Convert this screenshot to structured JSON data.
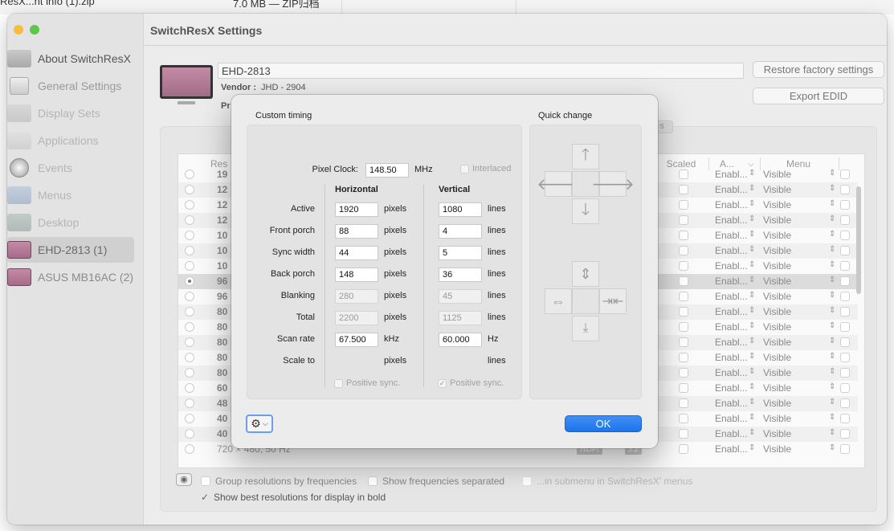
{
  "background": {
    "file_name": "ResX...nt info (1).zip",
    "file_meta": "7.0 MB — ZIP归档"
  },
  "window": {
    "title": "SwitchResX Settings"
  },
  "sidebar": {
    "items": [
      {
        "label": "About SwitchResX"
      },
      {
        "label": "General Settings"
      },
      {
        "label": "Display Sets"
      },
      {
        "label": "Applications"
      },
      {
        "label": "Events"
      },
      {
        "label": "Menus"
      },
      {
        "label": "Desktop"
      },
      {
        "label": "EHD-2813 (1)"
      },
      {
        "label": "ASUS MB16AC (2)"
      }
    ]
  },
  "display": {
    "name": "EHD-2813",
    "vendor_label": "Vendor :",
    "vendor_value": "JHD - 2904",
    "pr_label": "Pr",
    "restore_button": "Restore factory settings",
    "export_button": "Export EDID",
    "tab_hint": "s"
  },
  "table": {
    "headers": {
      "res": "Res",
      "scaled": "Scaled",
      "a": "A...",
      "menu": "Menu"
    },
    "rows": [
      {
        "res": "19",
        "enabled": "Enabl...",
        "visible": "Visible",
        "selected": false,
        "bold": true
      },
      {
        "res": "12",
        "enabled": "Enabl...",
        "visible": "Visible",
        "selected": false,
        "bold": true
      },
      {
        "res": "12",
        "enabled": "Enabl...",
        "visible": "Visible",
        "selected": false,
        "bold": true
      },
      {
        "res": "12",
        "enabled": "Enabl...",
        "visible": "Visible",
        "selected": false,
        "bold": true
      },
      {
        "res": "10",
        "enabled": "Enabl...",
        "visible": "Visible",
        "selected": false,
        "bold": true
      },
      {
        "res": "10",
        "enabled": "Enabl...",
        "visible": "Visible",
        "selected": false,
        "bold": true
      },
      {
        "res": "10",
        "enabled": "Enabl...",
        "visible": "Visible",
        "selected": false,
        "bold": true
      },
      {
        "res": "96",
        "enabled": "Enabl...",
        "visible": "Visible",
        "selected": true,
        "bold": true
      },
      {
        "res": "96",
        "enabled": "Enabl...",
        "visible": "Visible",
        "selected": false,
        "bold": true
      },
      {
        "res": "80",
        "enabled": "Enabl...",
        "visible": "Visible",
        "selected": false,
        "bold": true
      },
      {
        "res": "80",
        "enabled": "Enabl...",
        "visible": "Visible",
        "selected": false,
        "bold": true
      },
      {
        "res": "80",
        "enabled": "Enabl...",
        "visible": "Visible",
        "selected": false,
        "bold": true
      },
      {
        "res": "80",
        "enabled": "Enabl...",
        "visible": "Visible",
        "selected": false,
        "bold": true
      },
      {
        "res": "80",
        "enabled": "Enabl...",
        "visible": "Visible",
        "selected": false,
        "bold": true
      },
      {
        "res": "60",
        "enabled": "Enabl...",
        "visible": "Visible",
        "selected": false,
        "bold": true
      },
      {
        "res": "48",
        "enabled": "Enabl...",
        "visible": "Visible",
        "selected": false,
        "bold": true
      },
      {
        "res": "40",
        "enabled": "Enabl...",
        "visible": "Visible",
        "selected": false,
        "bold": true
      },
      {
        "res": "40",
        "enabled": "Enabl...",
        "visible": "Visible",
        "selected": false,
        "bold": true
      },
      {
        "res": "720 × 480, 50 Hz",
        "enabled": "Enabl...",
        "visible": "Visible",
        "selected": false,
        "bold": false,
        "badge1": "HiDPI",
        "badge2": "3:2"
      }
    ]
  },
  "options": {
    "group_by_freq": "Group resolutions by frequencies",
    "show_freq_separated": "Show frequencies separated",
    "in_submenu": "...in submenu in SwitchResX' menus",
    "show_best_bold": "Show best resolutions for display in bold"
  },
  "dialog": {
    "custom_timing_title": "Custom timing",
    "quick_change_title": "Quick change",
    "pixel_clock_label": "Pixel Clock:",
    "pixel_clock_value": "148.50",
    "pixel_clock_unit": "MHz",
    "interlaced_label": "Interlaced",
    "horizontal_head": "Horizontal",
    "vertical_head": "Vertical",
    "rows": [
      {
        "label": "Active",
        "h": "1920",
        "h_unit": "pixels",
        "v": "1080",
        "v_unit": "lines",
        "disabled": false
      },
      {
        "label": "Front porch",
        "h": "88",
        "h_unit": "pixels",
        "v": "4",
        "v_unit": "lines",
        "disabled": false
      },
      {
        "label": "Sync width",
        "h": "44",
        "h_unit": "pixels",
        "v": "5",
        "v_unit": "lines",
        "disabled": false
      },
      {
        "label": "Back porch",
        "h": "148",
        "h_unit": "pixels",
        "v": "36",
        "v_unit": "lines",
        "disabled": false
      },
      {
        "label": "Blanking",
        "h": "280",
        "h_unit": "pixels",
        "v": "45",
        "v_unit": "lines",
        "disabled": true
      },
      {
        "label": "Total",
        "h": "2200",
        "h_unit": "pixels",
        "v": "1125",
        "v_unit": "lines",
        "disabled": true
      },
      {
        "label": "Scan rate",
        "h": "67.500",
        "h_unit": "kHz",
        "v": "60.000",
        "v_unit": "Hz",
        "disabled": false
      },
      {
        "label": "Scale to",
        "h": "",
        "h_unit": "pixels",
        "v": "",
        "v_unit": "lines",
        "disabled": false,
        "no_fields": true
      }
    ],
    "h_positive_sync": "Positive sync.",
    "v_positive_sync": "Positive sync.",
    "ok_button": "OK"
  }
}
